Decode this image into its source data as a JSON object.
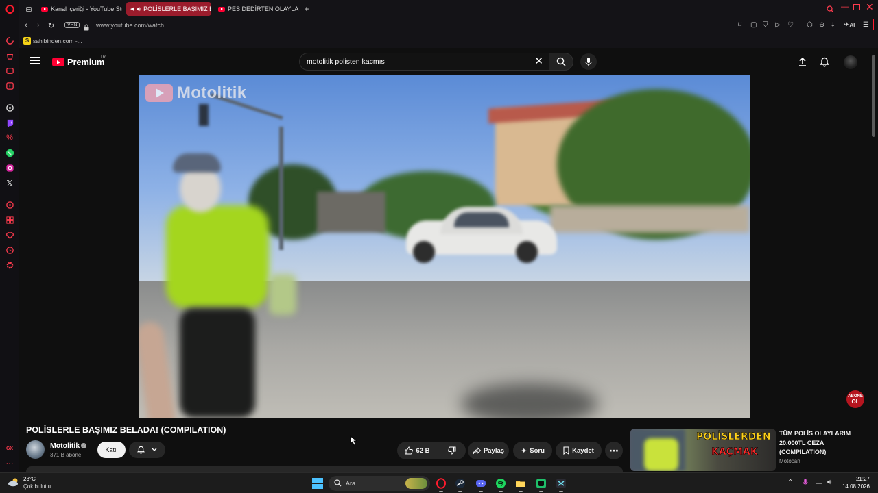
{
  "browser": {
    "tabs": [
      {
        "label": "Kanal içeriği - YouTube Stu",
        "active": false
      },
      {
        "label": "POLİSLERLE BAŞIMIZ B",
        "active": true
      },
      {
        "label": "PES DEDİRTEN OLAYLARI",
        "active": false
      }
    ],
    "new_tab": "+",
    "vpn_label": "VPN",
    "url": "www.youtube.com/watch",
    "ai_label": "AI",
    "bookmarks": [
      {
        "label": "sahibinden.com -...",
        "favicon": "S"
      }
    ]
  },
  "youtube": {
    "logo_text": "Premium",
    "region": "TR",
    "search_value": "motolitik polisten kacmıs",
    "video": {
      "watermark": "Motolitik",
      "title": "POLİSLERLE BAŞIMIZ BELADA! (COMPILATION)",
      "subscribe_badge_line1": "ABONE",
      "subscribe_badge_line2": "OL"
    },
    "channel": {
      "name": "Motolitik",
      "verified_mark": "✓",
      "subscribers": "371 B abone",
      "join_label": "Katıl"
    },
    "actions": {
      "likes": "62 B",
      "share": "Paylaş",
      "ask": "Soru",
      "save": "Kaydet"
    },
    "recommendation": {
      "title": "TÜM POLİS OLAYLARIM 20.000TL CEZA (COMPILATION)",
      "channel": "Motocan",
      "thumb_text_1": "POLİSLERDEN",
      "thumb_text_2": "KAÇMAK"
    }
  },
  "taskbar": {
    "weather_temp": "23°C",
    "weather_desc": "Çok bulutlu",
    "search_label": "Ara",
    "time": "21:27",
    "date": "14.08.2026"
  },
  "colors": {
    "opera_red": "#ff1b2d",
    "youtube_red": "#ff0033",
    "active_tab": "#9b1c2c",
    "windows_blue": "#4cc2ff"
  }
}
